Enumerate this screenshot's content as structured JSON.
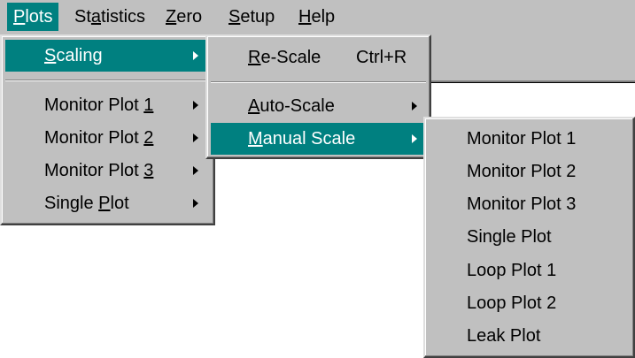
{
  "menubar": {
    "items": [
      {
        "pre": "",
        "u": "P",
        "post": "lots"
      },
      {
        "pre": "St",
        "u": "a",
        "post": "tistics"
      },
      {
        "pre": "",
        "u": "Z",
        "post": "ero"
      },
      {
        "pre": "",
        "u": "S",
        "post": "etup"
      },
      {
        "pre": "",
        "u": "H",
        "post": "elp"
      }
    ]
  },
  "plots_menu": {
    "scaling": {
      "pre": "",
      "u": "S",
      "post": "caling"
    },
    "monitor1": {
      "pre": "Monitor Plot ",
      "u": "1",
      "post": ""
    },
    "monitor2": {
      "pre": "Monitor Plot ",
      "u": "2",
      "post": ""
    },
    "monitor3": {
      "pre": "Monitor Plot ",
      "u": "3",
      "post": ""
    },
    "single": {
      "pre": "Single ",
      "u": "P",
      "post": "lot"
    }
  },
  "scaling_menu": {
    "rescale": {
      "pre": "",
      "u": "R",
      "post": "e-Scale",
      "shortcut": "Ctrl+R"
    },
    "autoscale": {
      "pre": "",
      "u": "A",
      "post": "uto-Scale"
    },
    "manualscale": {
      "pre": "",
      "u": "M",
      "post": "anual Scale"
    }
  },
  "manual_menu": {
    "items": [
      "Monitor Plot 1",
      "Monitor Plot 2",
      "Monitor Plot 3",
      "Single Plot",
      "Loop Plot 1",
      "Loop Plot 2",
      "Leak Plot"
    ]
  },
  "colors": {
    "menu_bg": "#c0c0c0",
    "highlight": "#008080"
  }
}
